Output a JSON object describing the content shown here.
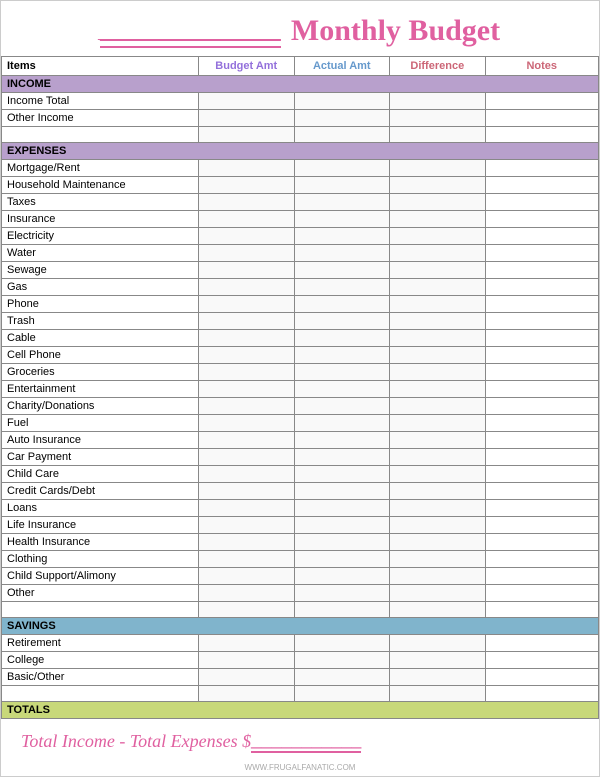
{
  "header": {
    "title": "Monthly Budget",
    "underline_placeholder": "___________"
  },
  "columns": {
    "items": "Items",
    "budget_amt": "Budget Amt",
    "actual_amt": "Actual Amt",
    "difference": "Difference",
    "notes": "Notes"
  },
  "sections": {
    "income": {
      "label": "INCOME",
      "rows": [
        {
          "label": "Income Total"
        },
        {
          "label": "Other Income"
        },
        {
          "label": ""
        }
      ]
    },
    "expenses": {
      "label": "EXPENSES",
      "rows": [
        {
          "label": "Mortgage/Rent"
        },
        {
          "label": "Household Maintenance"
        },
        {
          "label": "Taxes"
        },
        {
          "label": "Insurance"
        },
        {
          "label": "Electricity"
        },
        {
          "label": "Water"
        },
        {
          "label": "Sewage"
        },
        {
          "label": "Gas"
        },
        {
          "label": "Phone"
        },
        {
          "label": "Trash"
        },
        {
          "label": "Cable"
        },
        {
          "label": "Cell Phone"
        },
        {
          "label": "Groceries"
        },
        {
          "label": "Entertainment"
        },
        {
          "label": "Charity/Donations"
        },
        {
          "label": "Fuel"
        },
        {
          "label": "Auto Insurance"
        },
        {
          "label": "Car Payment"
        },
        {
          "label": "Child Care"
        },
        {
          "label": "Credit Cards/Debt"
        },
        {
          "label": "Loans"
        },
        {
          "label": "Life Insurance"
        },
        {
          "label": "Health Insurance"
        },
        {
          "label": "Clothing"
        },
        {
          "label": "Child Support/Alimony"
        },
        {
          "label": "Other"
        },
        {
          "label": ""
        }
      ]
    },
    "savings": {
      "label": "SAVINGS",
      "rows": [
        {
          "label": "Retirement"
        },
        {
          "label": "College"
        },
        {
          "label": "Basic/Other"
        },
        {
          "label": ""
        }
      ]
    },
    "totals": {
      "label": "TOTALS"
    }
  },
  "footer": {
    "text": "Total Income - Total Expenses $",
    "underline": "___________"
  },
  "watermark": "WWW.FRUGALFANATIC.COM"
}
